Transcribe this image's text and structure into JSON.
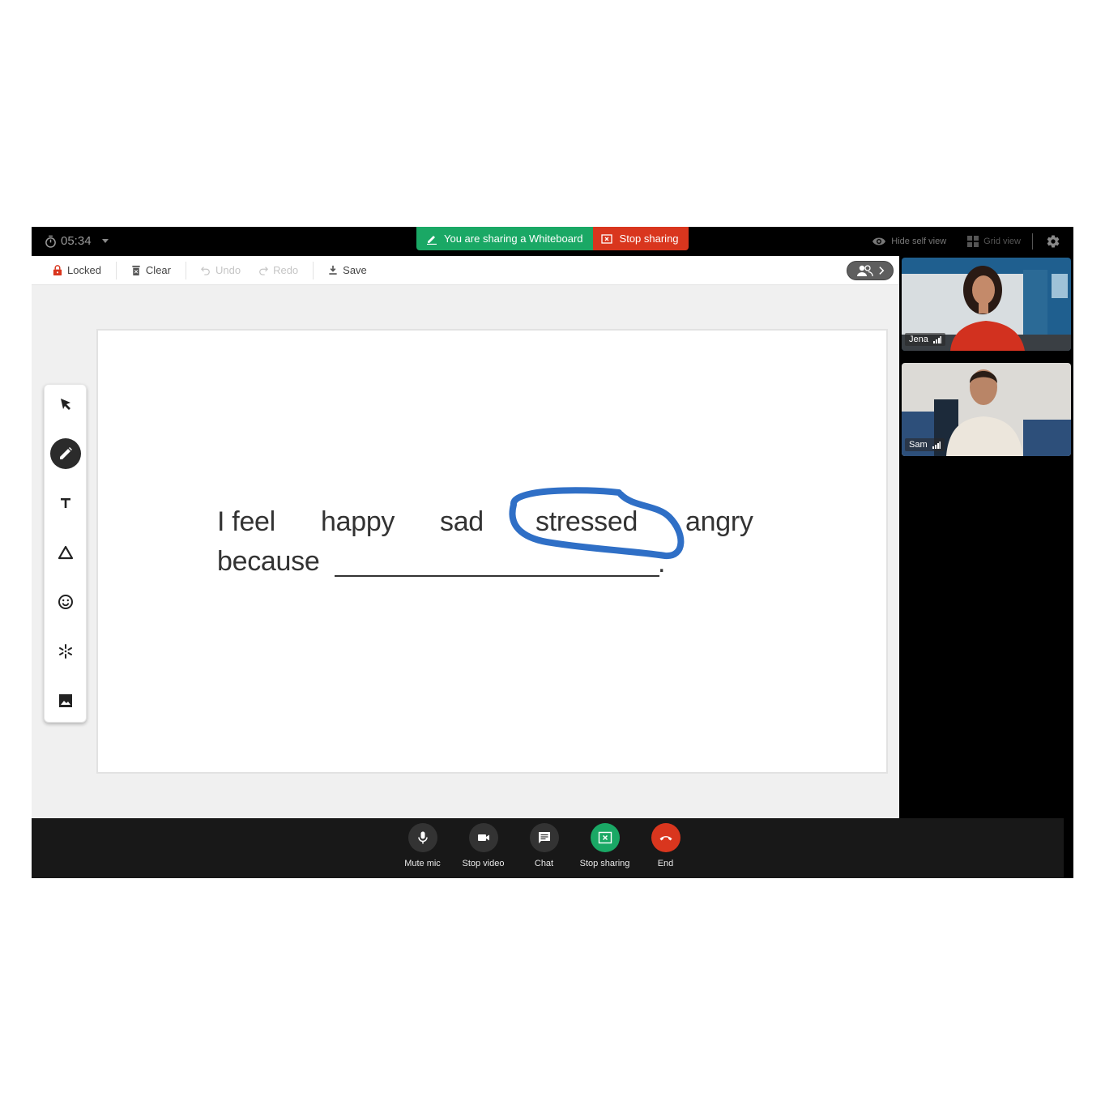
{
  "topbar": {
    "timer": "05:34",
    "share_message": "You are sharing a Whiteboard",
    "stop_sharing_label": "Stop sharing",
    "hide_self_view_label": "Hide self view",
    "grid_view_label": "Grid view",
    "colors": {
      "share_green": "#1aa865",
      "stop_red": "#d9361e"
    }
  },
  "toolbar": {
    "locked_label": "Locked",
    "clear_label": "Clear",
    "undo_label": "Undo",
    "redo_label": "Redo",
    "save_label": "Save",
    "undo_enabled": false,
    "redo_enabled": false
  },
  "tools": [
    {
      "name": "select",
      "icon": "cursor-arrow-icon",
      "active": false
    },
    {
      "name": "pen",
      "icon": "pencil-icon",
      "active": true
    },
    {
      "name": "text",
      "icon": "text-icon",
      "active": false
    },
    {
      "name": "shape",
      "icon": "triangle-icon",
      "active": false
    },
    {
      "name": "sticker",
      "icon": "smiley-icon",
      "active": false
    },
    {
      "name": "effects",
      "icon": "sparkle-icon",
      "active": false
    },
    {
      "name": "image",
      "icon": "image-icon",
      "active": false
    }
  ],
  "whiteboard": {
    "line1": [
      "I feel",
      "happy",
      "sad",
      "stressed",
      "angry"
    ],
    "line2_prefix": "because",
    "line2_suffix": ".",
    "circled_word": "stressed",
    "ink_color": "#2f6fc6"
  },
  "participants": [
    {
      "name": "Jena",
      "signal": "signal-bars-icon"
    },
    {
      "name": "Sam",
      "signal": "signal-bars-icon"
    }
  ],
  "controls": [
    {
      "label": "Mute mic",
      "icon": "microphone-icon",
      "color": "#333333"
    },
    {
      "label": "Stop video",
      "icon": "video-camera-icon",
      "color": "#333333"
    },
    {
      "label": "Chat",
      "icon": "chat-icon",
      "color": "#333333"
    },
    {
      "label": "Stop sharing",
      "icon": "stop-share-icon",
      "color": "#1aa865"
    },
    {
      "label": "End",
      "icon": "hang-up-icon",
      "color": "#d9361e"
    }
  ]
}
